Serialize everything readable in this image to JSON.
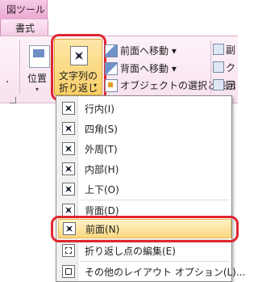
{
  "ribbon": {
    "context_tab": "図ツール",
    "tab": "書式",
    "group_dot": "・",
    "position_button": {
      "label": "位置",
      "arrow": "▾"
    },
    "wrap_button": {
      "label_line1": "文字列の",
      "label_line2": "折り返し",
      "arrow": "▾"
    },
    "bring_forward": {
      "label": "前面へ移動",
      "arrow": "▾"
    },
    "send_backward": {
      "label": "背面へ移動",
      "arrow": "▾"
    },
    "selection_pane": {
      "label": "オブジェクトの選択と表示"
    },
    "right_col": [
      "副",
      "ク",
      "回"
    ]
  },
  "menu": {
    "items": [
      {
        "label": "行内(I)",
        "icon": "inline-wrap-icon"
      },
      {
        "label": "四角(S)",
        "icon": "square-wrap-icon"
      },
      {
        "label": "外周(T)",
        "icon": "tight-wrap-icon"
      },
      {
        "label": "内部(H)",
        "icon": "through-wrap-icon"
      },
      {
        "label": "上下(O)",
        "icon": "top-bottom-wrap-icon"
      },
      {
        "label": "背面(D)",
        "icon": "behind-text-icon"
      },
      {
        "label": "前面(N)",
        "icon": "in-front-text-icon",
        "highlighted": true
      },
      {
        "label": "折り返し点の編集(E)",
        "icon": "edit-wrap-points-icon"
      },
      {
        "label": "その他のレイアウト オプション(L)...",
        "icon": "more-layout-options-icon"
      }
    ]
  },
  "colors": {
    "context_tab": "#e9a9d1",
    "highlight": "#fbd880",
    "annotation_ring": "#e0262e"
  }
}
